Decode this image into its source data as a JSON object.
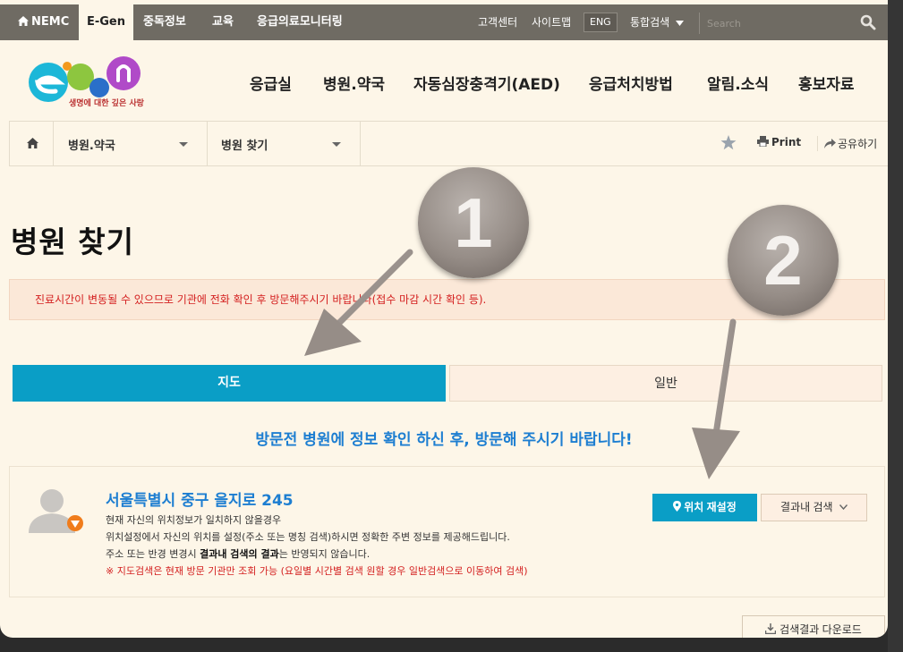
{
  "topbar": {
    "nav": [
      {
        "label": "NEMC"
      },
      {
        "label": "E-Gen",
        "active": true
      },
      {
        "label": "중독정보"
      },
      {
        "label": "교육"
      },
      {
        "label": "응급의료모니터링"
      }
    ],
    "util": {
      "customer_center": "고객센터",
      "sitemap": "사이트맵",
      "eng": "ENG",
      "integrated_search": "통합검색"
    },
    "search_placeholder": "Search"
  },
  "logo": {
    "tagline": "생명에 대한 깊은 사랑"
  },
  "gnb": [
    "응급실",
    "병원.약국",
    "자동심장충격기(AED)",
    "응급처치방법",
    "알림.소식",
    "홍보자료"
  ],
  "breadcrumb": {
    "level1": "병원.약국",
    "level2": "병원 찾기",
    "print": "Print",
    "share": "공유하기"
  },
  "page_title": "병원 찾기",
  "notice": "진료시간이 변동될 수 있으므로 기관에 전화 확인 후 방문해주시기 바랍니다(접수 마감 시간 확인 등).",
  "tabs": [
    {
      "label": "지도",
      "active": true
    },
    {
      "label": "일반",
      "active": false
    }
  ],
  "guide": "방문전 병원에 정보 확인 하신 후, 방문해 주시기 바랍니다!",
  "location": {
    "address": "서울특별시 중구 을지로 245",
    "line1": "현재 자신의 위치정보가 일치하지 않을경우",
    "line2": "위치설정에서 자신의 위치를 설정(주소 또는 명칭 검색)하시면 정확한 주변 정보를 제공해드립니다.",
    "line3_pre": "주소 또는 반경 변경시 ",
    "line3_bold": "결과내 검색의 결과",
    "line3_post": "는 반영되지 않습니다.",
    "warning": "※ 지도검색은 현재 방문 기관만 조회 가능 (요일별 시간별 검색 원할 경우 일반검색으로 이동하여 검색)",
    "reset_button": "위치 재설정",
    "insearch_button": "결과내 검색"
  },
  "download_button": "검색결과 다운로드",
  "annotations": {
    "badge1": "1",
    "badge2": "2"
  },
  "colors": {
    "accent": "#0a9ec6",
    "link": "#1d7ed1",
    "warning": "#d42020",
    "background": "#fdf6e8",
    "topbar": "#6f6b63"
  }
}
